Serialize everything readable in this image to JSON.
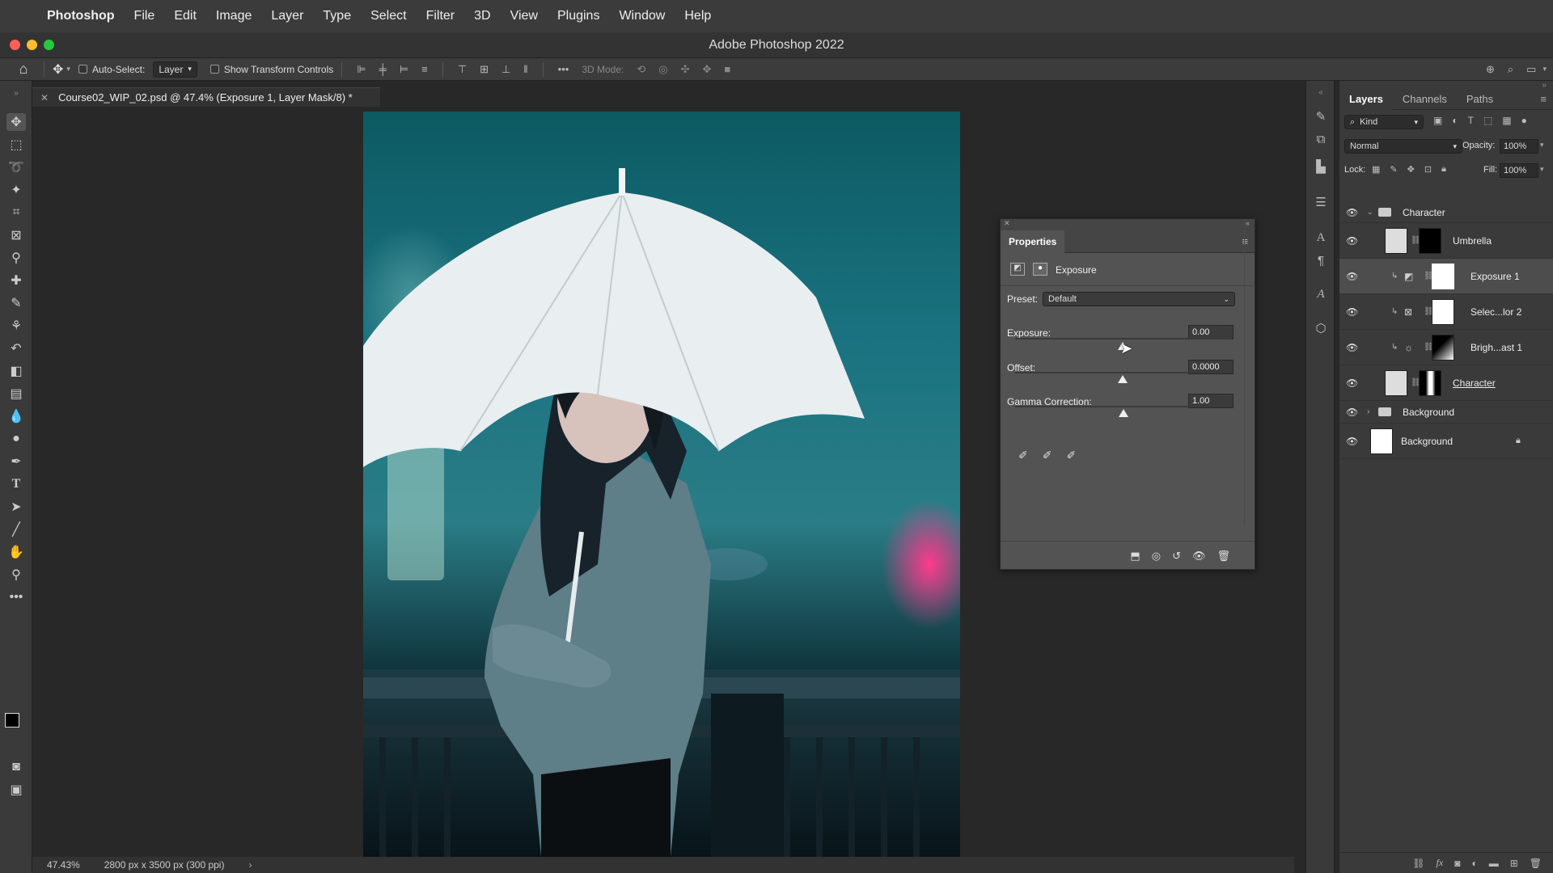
{
  "menubar": {
    "app": "Photoshop",
    "items": [
      "File",
      "Edit",
      "Image",
      "Layer",
      "Type",
      "Select",
      "Filter",
      "3D",
      "View",
      "Plugins",
      "Window",
      "Help"
    ]
  },
  "window": {
    "title": "Adobe Photoshop 2022"
  },
  "options": {
    "auto_select_label": "Auto-Select:",
    "auto_select_value": "Layer",
    "transform_label": "Show Transform Controls",
    "mode_label": "3D Mode:"
  },
  "document": {
    "tab": "Course02_WIP_02.psd @ 47.4% (Exposure 1, Layer Mask/8) *"
  },
  "status": {
    "zoom": "47.43%",
    "size": "2800 px x 3500 px (300 ppi)"
  },
  "layers_panel": {
    "tabs": [
      "Layers",
      "Channels",
      "Paths"
    ],
    "kind_label": "Kind",
    "blend_mode": "Normal",
    "opacity_label": "Opacity:",
    "opacity_value": "100%",
    "lock_label": "Lock:",
    "fill_label": "Fill:",
    "fill_value": "100%",
    "layers": [
      {
        "name": "Character",
        "type": "group",
        "expanded": true
      },
      {
        "name": "Umbrella",
        "type": "pixel"
      },
      {
        "name": "Exposure 1",
        "type": "adjustment",
        "selected": true
      },
      {
        "name": "Selec...lor 2",
        "type": "adjustment"
      },
      {
        "name": "Brigh...ast 1",
        "type": "adjustment"
      },
      {
        "name": "Character",
        "type": "pixel"
      },
      {
        "name": "Background",
        "type": "group",
        "expanded": false
      },
      {
        "name": "Background",
        "type": "pixel",
        "locked": true
      }
    ]
  },
  "properties": {
    "title": "Properties",
    "adjustment": "Exposure",
    "preset_label": "Preset:",
    "preset_value": "Default",
    "exposure_label": "Exposure:",
    "exposure_value": "0.00",
    "offset_label": "Offset:",
    "offset_value": "0.0000",
    "gamma_label": "Gamma Correction:",
    "gamma_value": "1.00"
  },
  "colors": {
    "accent_pink": "#e0307a",
    "panel": "#3a3a3a",
    "canvas_bg": "#282828"
  }
}
